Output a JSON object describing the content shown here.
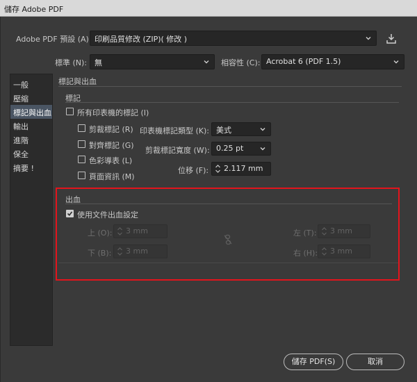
{
  "window": {
    "title": "儲存 Adobe PDF"
  },
  "preset": {
    "label": "Adobe PDF 預設 (A):",
    "value": "印刷品質修改 (ZIP)( 修改 )"
  },
  "standard": {
    "label": "標準 (N):",
    "value": "無"
  },
  "compatibility": {
    "label": "相容性 (C):",
    "value": "Acrobat 6 (PDF 1.5)"
  },
  "sidebar": {
    "items": [
      {
        "label": "一般"
      },
      {
        "label": "壓縮"
      },
      {
        "label": "標記與出血"
      },
      {
        "label": "輸出"
      },
      {
        "label": "進階"
      },
      {
        "label": "保全"
      },
      {
        "label": "摘要 !"
      }
    ],
    "active_index": 2
  },
  "section": {
    "title": "標記與出血"
  },
  "marks": {
    "group_title": "標記",
    "all_printer_marks": {
      "label": "所有印表機的標記 (I)",
      "checked": false
    },
    "trim_marks": {
      "label": "剪裁標記 (R)",
      "checked": false
    },
    "registration_marks": {
      "label": "對齊標記 (G)",
      "checked": false
    },
    "color_bars": {
      "label": "色彩導表 (L)",
      "checked": false
    },
    "page_info": {
      "label": "頁面資訊 (M)",
      "checked": false
    },
    "mark_type": {
      "label": "印表機標記類型 (K):",
      "value": "美式"
    },
    "trim_weight": {
      "label": "剪裁標記寬度 (W):",
      "value": "0.25 pt"
    },
    "offset": {
      "label": "位移 (F):",
      "value": "2.117 mm"
    }
  },
  "bleed": {
    "group_title": "出血",
    "use_doc_bleed": {
      "label": "使用文件出血設定",
      "checked": true
    },
    "top": {
      "label": "上 (O):",
      "value": "3 mm"
    },
    "bottom": {
      "label": "下 (B):",
      "value": "3 mm"
    },
    "left": {
      "label": "左 (T):",
      "value": "3 mm"
    },
    "right": {
      "label": "右 (H):",
      "value": "3 mm"
    }
  },
  "buttons": {
    "save": "儲存 PDF(S)",
    "cancel": "取消"
  },
  "colors": {
    "highlight": "#e3141c",
    "active_item": "#4a5563",
    "background": "#3a3a3a"
  }
}
